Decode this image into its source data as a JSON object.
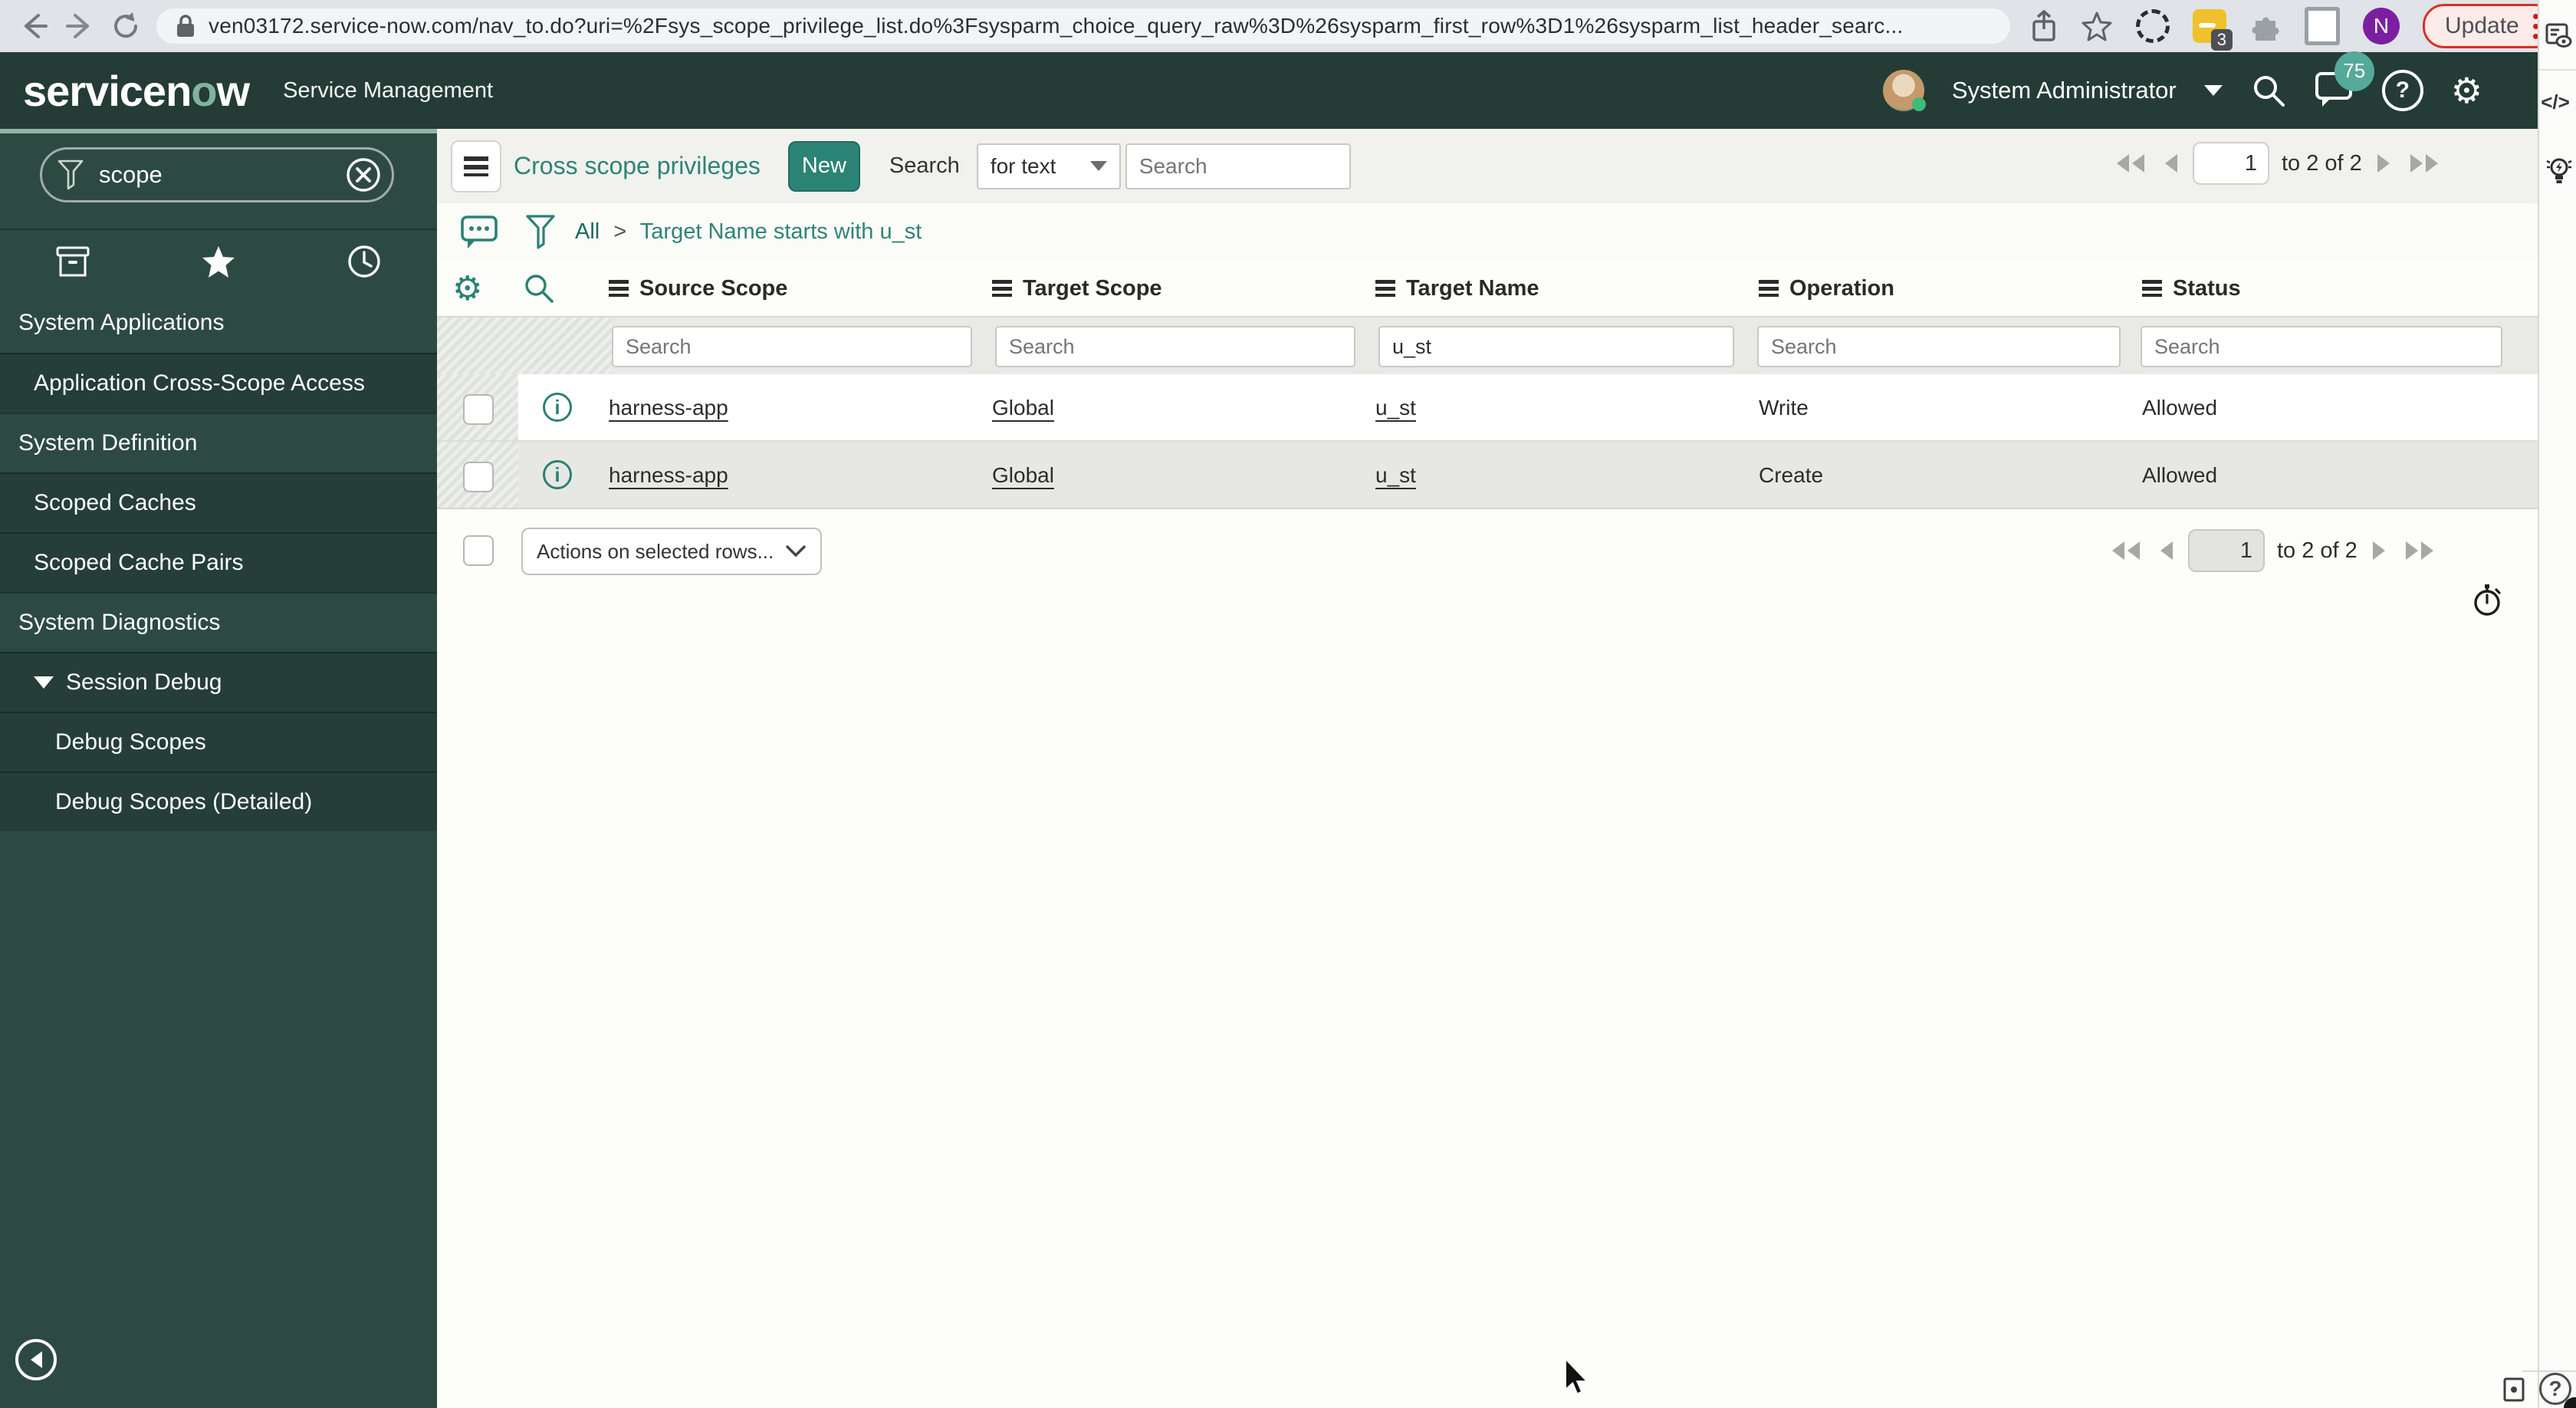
{
  "browser": {
    "url": "ven03172.service-now.com/nav_to.do?uri=%2Fsys_scope_privilege_list.do%3Fsysparm_choice_query_raw%3D%26sysparm_first_row%3D1%26sysparm_list_header_searc...",
    "update_label": "Update",
    "extension_badge": "3",
    "profile_initial": "N"
  },
  "banner": {
    "logo_pre": "servicen",
    "logo_accent": "o",
    "logo_post": "w",
    "product": "Service Management",
    "user": "System Administrator",
    "notification_count": "75"
  },
  "rail": {
    "code_glyph": "</>"
  },
  "sidebar": {
    "filter_value": "scope",
    "items": [
      {
        "label": "System Applications"
      },
      {
        "label": "Application Cross-Scope Access"
      },
      {
        "label": "System Definition"
      },
      {
        "label": "Scoped Caches"
      },
      {
        "label": "Scoped Cache Pairs"
      },
      {
        "label": "System Diagnostics"
      },
      {
        "label": "Session Debug"
      },
      {
        "label": "Debug Scopes"
      },
      {
        "label": "Debug Scopes (Detailed)"
      }
    ]
  },
  "list": {
    "title": "Cross scope privileges",
    "new_button": "New",
    "search_label": "Search",
    "search_type": "for text",
    "search_placeholder": "Search",
    "breadcrumb": {
      "root": "All",
      "separator": ">",
      "current": "Target Name starts with u_st"
    },
    "columns": [
      "Source Scope",
      "Target Scope",
      "Target Name",
      "Operation",
      "Status"
    ],
    "filter_placeholders": [
      "Search",
      "Search",
      "Search",
      "Search",
      "Search"
    ],
    "target_name_filter": "u_st",
    "rows": [
      {
        "source_scope": "harness-app",
        "target_scope": "Global",
        "target_name": "u_st",
        "operation": "Write",
        "status": "Allowed"
      },
      {
        "source_scope": "harness-app",
        "target_scope": "Global",
        "target_name": "u_st",
        "operation": "Create",
        "status": "Allowed"
      }
    ],
    "actions_placeholder": "Actions on selected rows...",
    "pagination": {
      "page": "1",
      "range": "to 2 of 2"
    }
  },
  "icons": {
    "nav_filter": "funnel",
    "clear": "circle-x",
    "all_applications": "box",
    "favorites": "star",
    "history": "clock",
    "menu": "hamburger",
    "list_chat": "speech-bubble",
    "list_filter": "funnel",
    "list_gear": "gear",
    "list_search": "magnifier",
    "row_info": "info-circle",
    "response_time": "stopwatch",
    "rail_form": "document-eye",
    "rail_code": "code-brackets",
    "rail_idea": "lightbulb",
    "help": "question-circle",
    "collapse": "circle-left-arrow"
  },
  "colors": {
    "accent": "#2b8173",
    "banner_green": "#243c35",
    "sidebar_green": "#2d4a42",
    "module_green": "#253e37",
    "badge_teal": "#55a99a",
    "update_red": "#d93025",
    "profile_purple": "#7b1fa2"
  }
}
